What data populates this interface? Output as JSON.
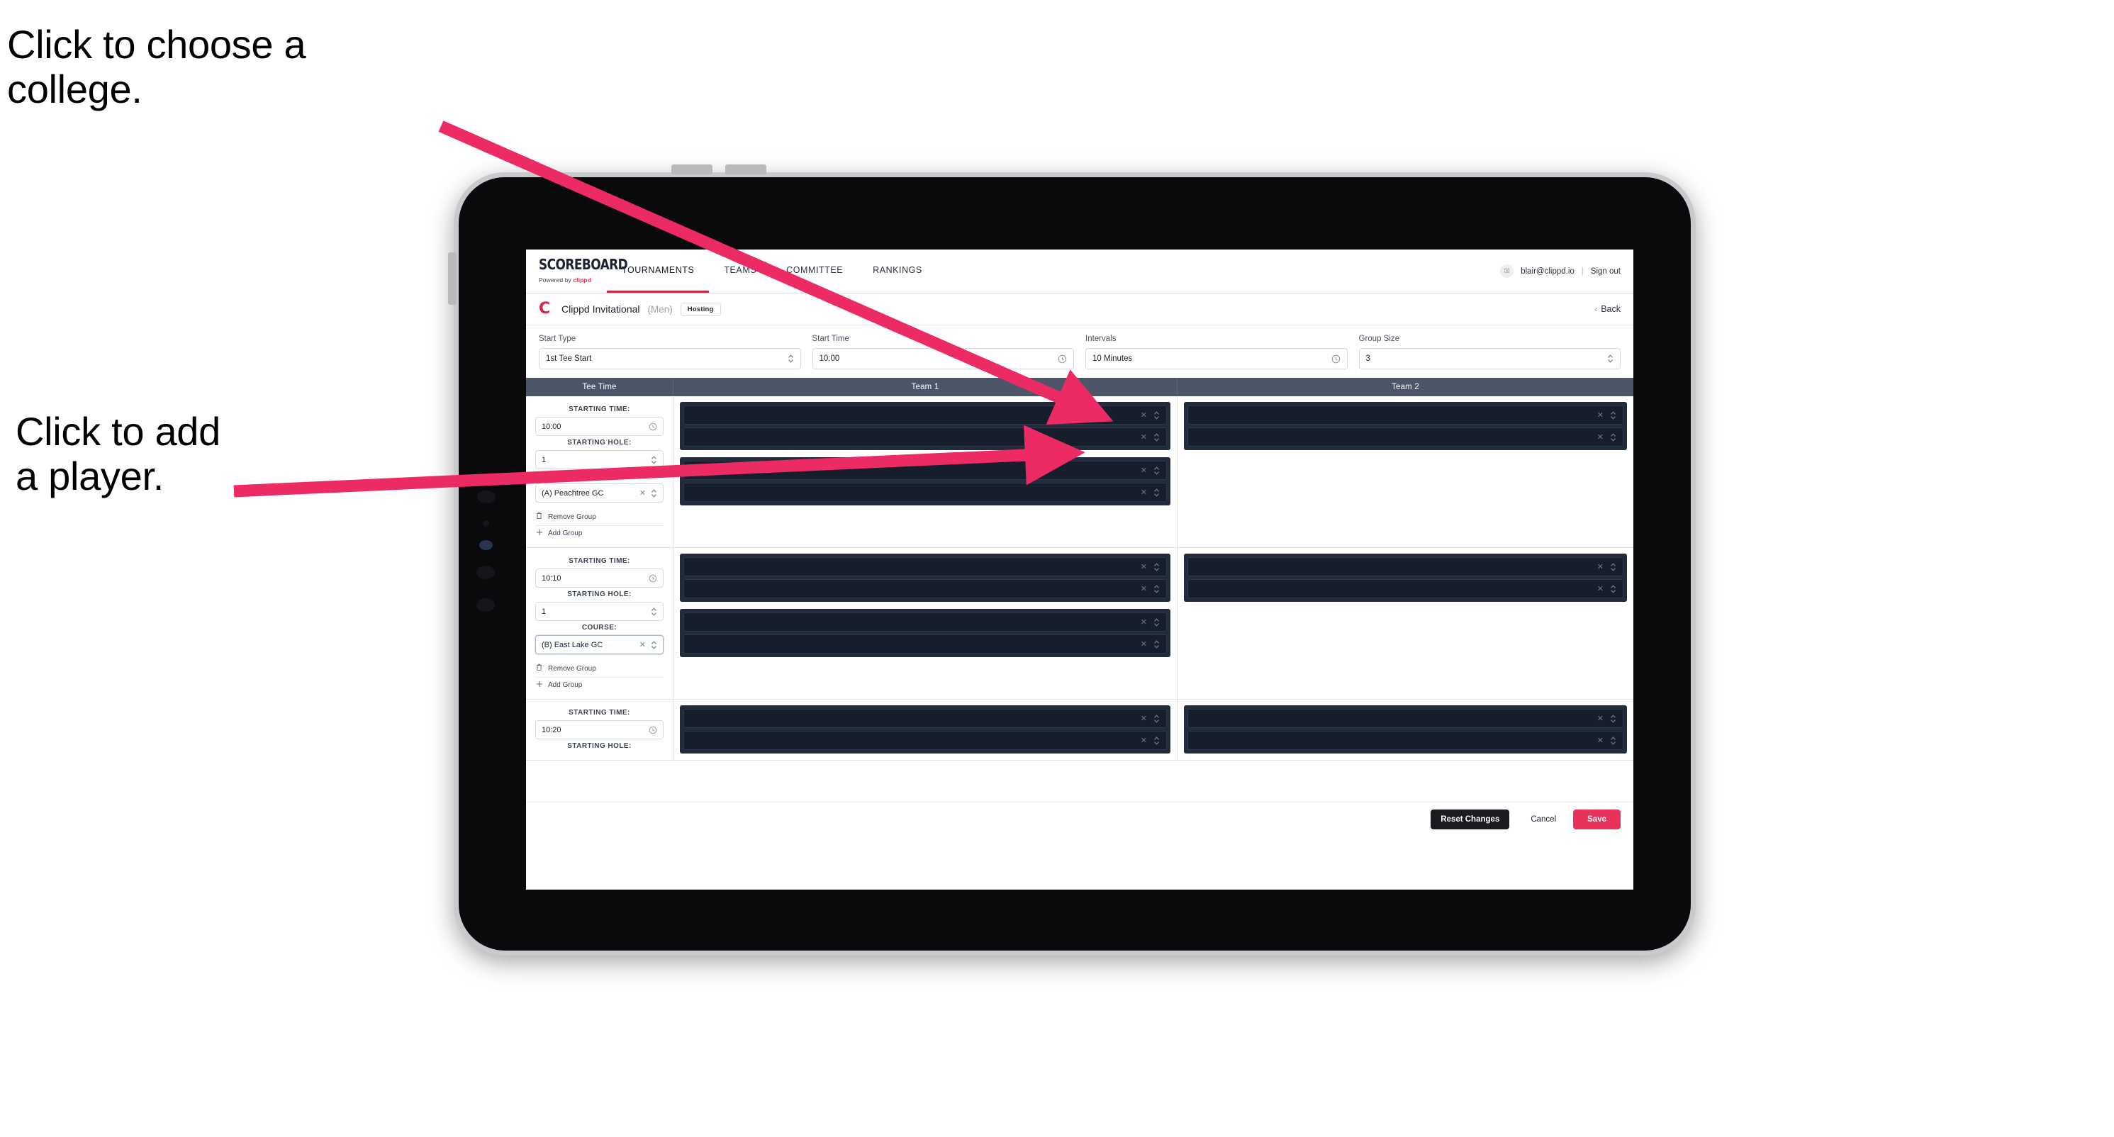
{
  "annotations": {
    "college": "Click to choose a\ncollege.",
    "player": "Click to add\na player.",
    "arrow_color": "#ec2a63"
  },
  "topnav": {
    "brand_word": "SCOREBOARD",
    "brand_powered_prefix": "Powered by ",
    "brand_powered_name": "clippd",
    "tabs": [
      {
        "label": "TOURNAMENTS",
        "active": true
      },
      {
        "label": "TEAMS",
        "active": false
      },
      {
        "label": "COMMITTEE",
        "active": false
      },
      {
        "label": "RANKINGS",
        "active": false
      }
    ],
    "avatar_glyph": "☒",
    "user_email": "blair@clippd.io",
    "separator": "|",
    "sign_out": "Sign out"
  },
  "tournament_bar": {
    "logo_letter": "C",
    "name": "Clippd Invitational",
    "gender": "(Men)",
    "badge": "Hosting",
    "back_chevron": "‹",
    "back_label": "Back"
  },
  "controls": [
    {
      "label": "Start Type",
      "value": "1st Tee Start",
      "icon": "stepper-icon"
    },
    {
      "label": "Start Time",
      "value": "10:00",
      "icon": "clock-icon"
    },
    {
      "label": "Intervals",
      "value": "10 Minutes",
      "icon": "clock-icon"
    },
    {
      "label": "Group Size",
      "value": "3",
      "icon": "stepper-icon"
    }
  ],
  "table": {
    "headers": [
      "Tee Time",
      "Team 1",
      "Team 2"
    ],
    "field_labels": {
      "starting_time": "STARTING TIME:",
      "starting_hole": "STARTING HOLE:",
      "course": "COURSE:"
    },
    "group_actions": {
      "remove": "Remove Group",
      "add": "Add Group",
      "remove_icon": "trash-icon",
      "add_icon": "plus-icon"
    },
    "clear_glyph": "✕",
    "stepper_glyph_up": "⌃",
    "stepper_glyph_down": "⌄",
    "groups": [
      {
        "starting_time": "10:00",
        "starting_hole": "1",
        "course": "(A) Peachtree GC",
        "course_focused": false,
        "team1": [
          {
            "players": [
              "redacted-player",
              "redacted-player"
            ]
          },
          {
            "players": [
              "redacted-player",
              "redacted-player"
            ]
          }
        ],
        "team2": [
          {
            "players": [
              "redacted-player",
              "redacted-player"
            ]
          }
        ]
      },
      {
        "starting_time": "10:10",
        "starting_hole": "1",
        "course": "(B) East Lake GC",
        "course_focused": true,
        "team1": [
          {
            "players": [
              "redacted-player",
              "redacted-player"
            ]
          },
          {
            "players": [
              "redacted-player",
              "redacted-player"
            ]
          }
        ],
        "team2": [
          {
            "players": [
              "redacted-player",
              "redacted-player"
            ]
          }
        ]
      },
      {
        "starting_time": "10:20",
        "starting_hole": "",
        "course": "",
        "course_focused": false,
        "partial": true,
        "team1": [
          {
            "players": [
              "redacted-player",
              "redacted-player"
            ]
          }
        ],
        "team2": [
          {
            "players": [
              "redacted-player",
              "redacted-player"
            ]
          }
        ]
      }
    ]
  },
  "footer": {
    "reset": "Reset Changes",
    "cancel": "Cancel",
    "save": "Save"
  }
}
